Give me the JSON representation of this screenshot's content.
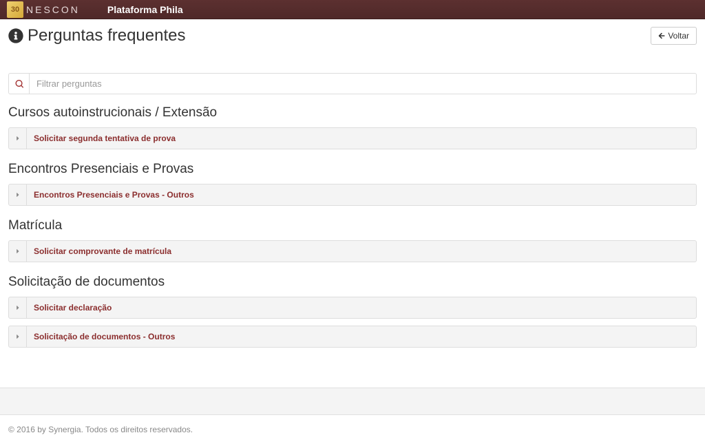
{
  "navbar": {
    "logo_text": "30",
    "brand": "NESCON",
    "platform": "Plataforma Phila"
  },
  "header": {
    "title": "Perguntas frequentes",
    "back_label": "Voltar"
  },
  "search": {
    "placeholder": "Filtrar perguntas"
  },
  "sections": [
    {
      "heading": "Cursos autoinstrucionais / Extensão",
      "items": [
        {
          "label": "Solicitar segunda tentativa de prova"
        }
      ]
    },
    {
      "heading": "Encontros Presenciais e Provas",
      "items": [
        {
          "label": "Encontros Presenciais e Provas - Outros"
        }
      ]
    },
    {
      "heading": "Matrícula",
      "items": [
        {
          "label": "Solicitar comprovante de matrícula"
        }
      ]
    },
    {
      "heading": "Solicitação de documentos",
      "items": [
        {
          "label": "Solicitar declaração"
        },
        {
          "label": "Solicitação de documentos - Outros"
        }
      ]
    }
  ],
  "footer": {
    "copyright": "© 2016 by Synergia. Todos os direitos reservados."
  }
}
